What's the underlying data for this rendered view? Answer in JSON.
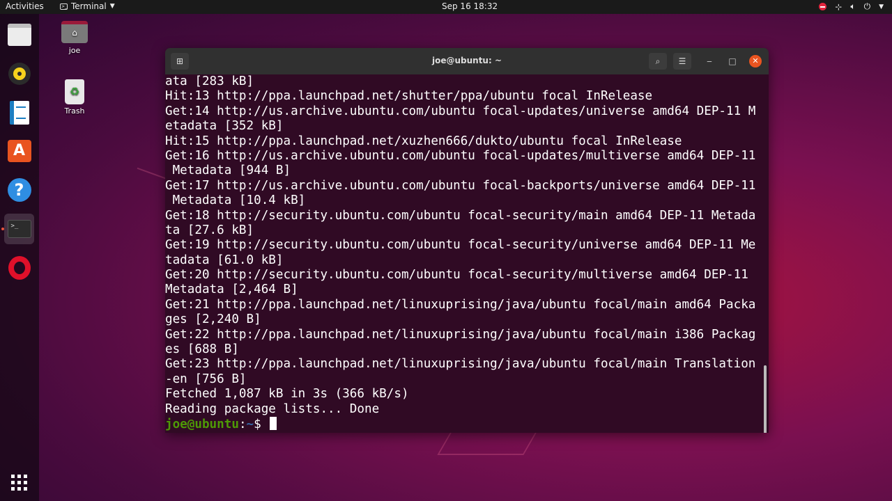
{
  "topbar": {
    "activities": "Activities",
    "app_menu": "Terminal",
    "clock": "Sep 16  18:32"
  },
  "desktop": {
    "icons": [
      {
        "label": "joe"
      },
      {
        "label": "Trash"
      }
    ]
  },
  "dock": {
    "items": [
      "files-icon",
      "rhythmbox-icon",
      "libreoffice-writer-icon",
      "ubuntu-software-icon",
      "help-icon",
      "terminal-icon",
      "opera-icon",
      "show-applications-icon"
    ],
    "terminal_glyph": ">_"
  },
  "terminal": {
    "title": "joe@ubuntu: ~",
    "lines": [
      "ata [283 kB]",
      "Hit:13 http://ppa.launchpad.net/shutter/ppa/ubuntu focal InRelease",
      "Get:14 http://us.archive.ubuntu.com/ubuntu focal-updates/universe amd64 DEP-11 M",
      "etadata [352 kB]",
      "Hit:15 http://ppa.launchpad.net/xuzhen666/dukto/ubuntu focal InRelease",
      "Get:16 http://us.archive.ubuntu.com/ubuntu focal-updates/multiverse amd64 DEP-11",
      " Metadata [944 B]",
      "Get:17 http://us.archive.ubuntu.com/ubuntu focal-backports/universe amd64 DEP-11",
      " Metadata [10.4 kB]",
      "Get:18 http://security.ubuntu.com/ubuntu focal-security/main amd64 DEP-11 Metada",
      "ta [27.6 kB]",
      "Get:19 http://security.ubuntu.com/ubuntu focal-security/universe amd64 DEP-11 Me",
      "tadata [61.0 kB]",
      "Get:20 http://security.ubuntu.com/ubuntu focal-security/multiverse amd64 DEP-11",
      "Metadata [2,464 B]",
      "Get:21 http://ppa.launchpad.net/linuxuprising/java/ubuntu focal/main amd64 Packa",
      "ges [2,240 B]",
      "Get:22 http://ppa.launchpad.net/linuxuprising/java/ubuntu focal/main i386 Packag",
      "es [688 B]",
      "Get:23 http://ppa.launchpad.net/linuxuprising/java/ubuntu focal/main Translation",
      "-en [756 B]",
      "Fetched 1,087 kB in 3s (366 kB/s)",
      "Reading package lists... Done"
    ],
    "prompt": {
      "user_host": "joe@ubuntu",
      "separator": ":",
      "path": "~",
      "symbol": "$ "
    }
  },
  "colors": {
    "terminal_bg": "#300a24",
    "prompt_user": "#4e9a06",
    "prompt_path": "#3465a4",
    "accent": "#e95420"
  }
}
